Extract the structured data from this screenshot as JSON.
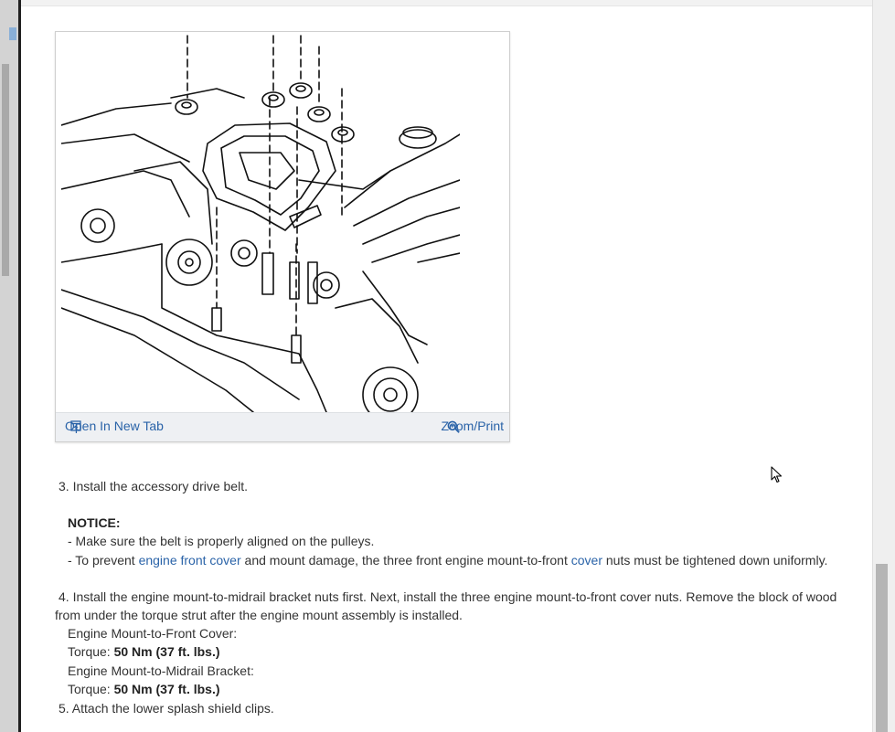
{
  "figure": {
    "open_in_new_tab": "Open In New Tab",
    "zoom_print": "Zoom/Print"
  },
  "steps": {
    "step3": "3. Install the accessory drive belt.",
    "notice_label": "NOTICE:",
    "notice_line1": "-  Make sure the belt is properly aligned on the pulleys.",
    "notice_line2_prefix": "-  To prevent ",
    "notice_line2_link1": "engine front cover",
    "notice_line2_mid": " and mount damage, the three front engine mount-to-front ",
    "notice_line2_link2": "cover",
    "notice_line2_suffix": " nuts must be tightened down uniformly.",
    "step4_line1": "4. Install the engine mount-to-midrail bracket nuts first. Next, install the three engine mount-to-front cover nuts. Remove the block of wood",
    "step4_line2": "from under the torque strut after the engine mount assembly is installed.",
    "spec1_label": "Engine Mount-to-Front Cover:",
    "torque_prefix": "Torque: ",
    "spec1_value": "50 Nm (37 ft. lbs.)",
    "spec2_label": "Engine Mount-to-Midrail Bracket:",
    "spec2_value": "50 Nm (37 ft. lbs.)",
    "step5": "5. Attach the lower splash shield clips."
  }
}
